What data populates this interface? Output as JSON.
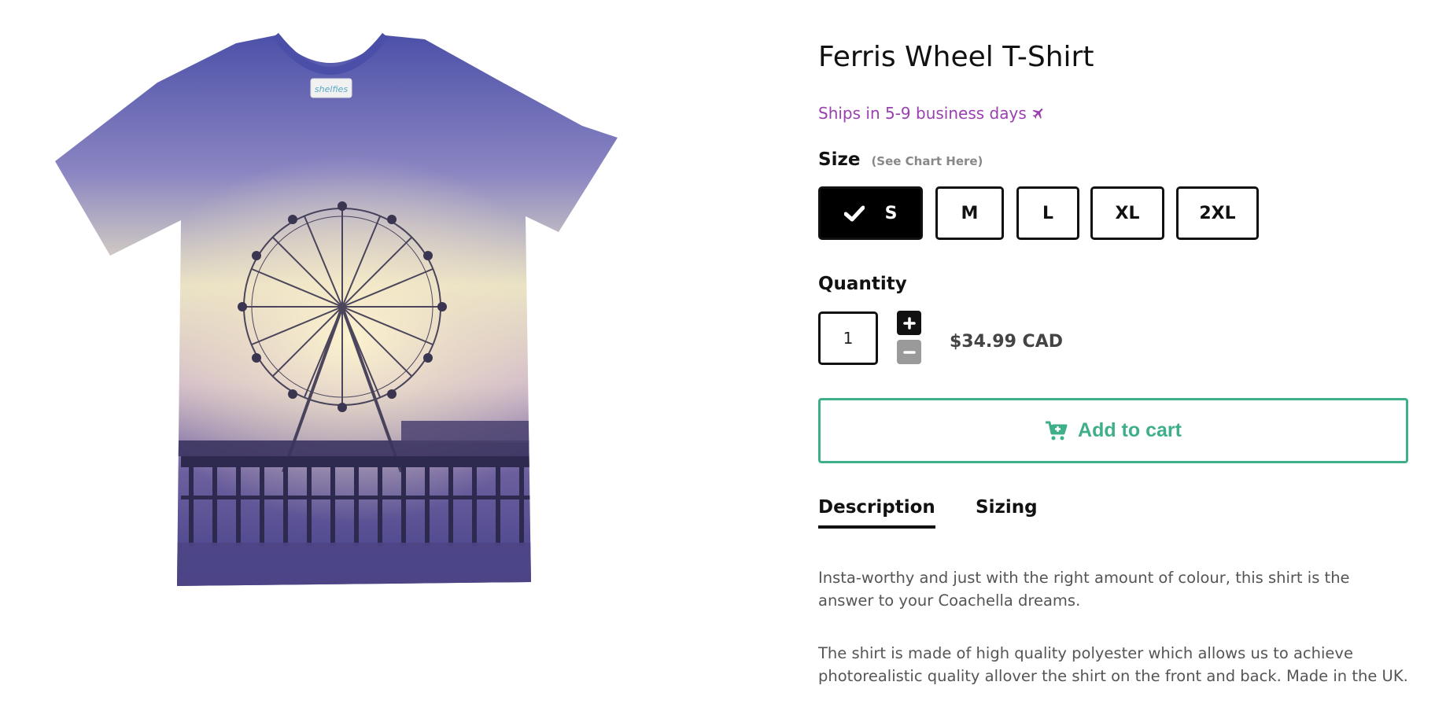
{
  "product": {
    "title": "Ferris Wheel T-Shirt",
    "ships": "Ships in 5-9 business days",
    "image_alt_brand": "shelfies"
  },
  "size": {
    "label": "Size",
    "chart_link": "(See Chart Here)",
    "options": [
      "S",
      "M",
      "L",
      "XL",
      "2XL"
    ],
    "selected": "S"
  },
  "quantity": {
    "label": "Quantity",
    "value": "1"
  },
  "price": "$34.99 CAD",
  "cart": {
    "label": "Add to cart"
  },
  "tabs": [
    {
      "label": "Description",
      "active": true
    },
    {
      "label": "Sizing",
      "active": false
    }
  ],
  "description": [
    "Insta-worthy and just with the right amount of colour, this shirt is the answer to your Coachella dreams.",
    "The shirt is made of high quality polyester which allows us to achieve photorealistic quality allover the shirt on the front and back. Made in the UK."
  ],
  "colors": {
    "accent": "#3fae8b",
    "ships": "#9b3fb0",
    "selected_size_bg": "#000000"
  }
}
